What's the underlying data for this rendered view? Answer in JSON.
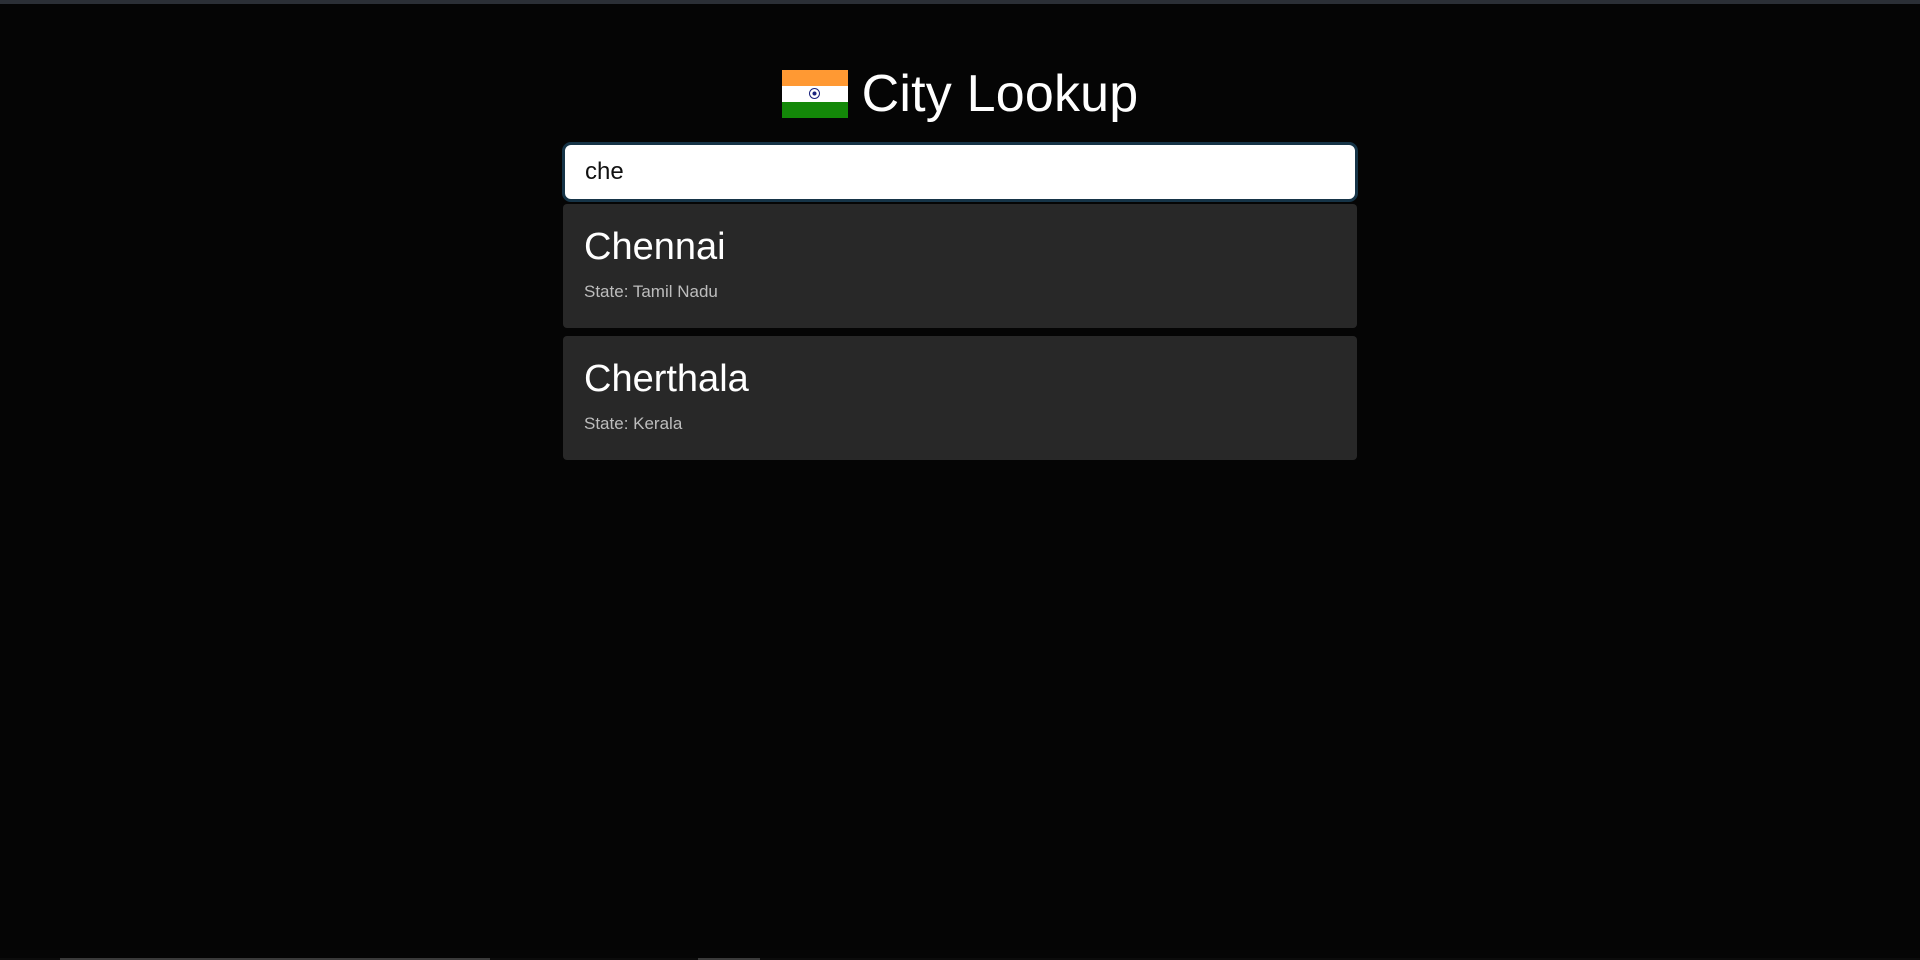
{
  "app": {
    "title": "City Lookup",
    "flag_icon": "india-flag-icon",
    "flag_colors": {
      "saffron": "#FF9933",
      "white": "#FFFFFF",
      "green": "#138808",
      "chakra": "#1a237e"
    }
  },
  "search": {
    "value": "che",
    "placeholder": ""
  },
  "results": [
    {
      "city": "Chennai",
      "state": "State: Tamil Nadu"
    },
    {
      "city": "Cherthala",
      "state": "State: Kerala"
    }
  ],
  "colors": {
    "background": "#050505",
    "card": "#282828",
    "input_border": "#163447"
  }
}
